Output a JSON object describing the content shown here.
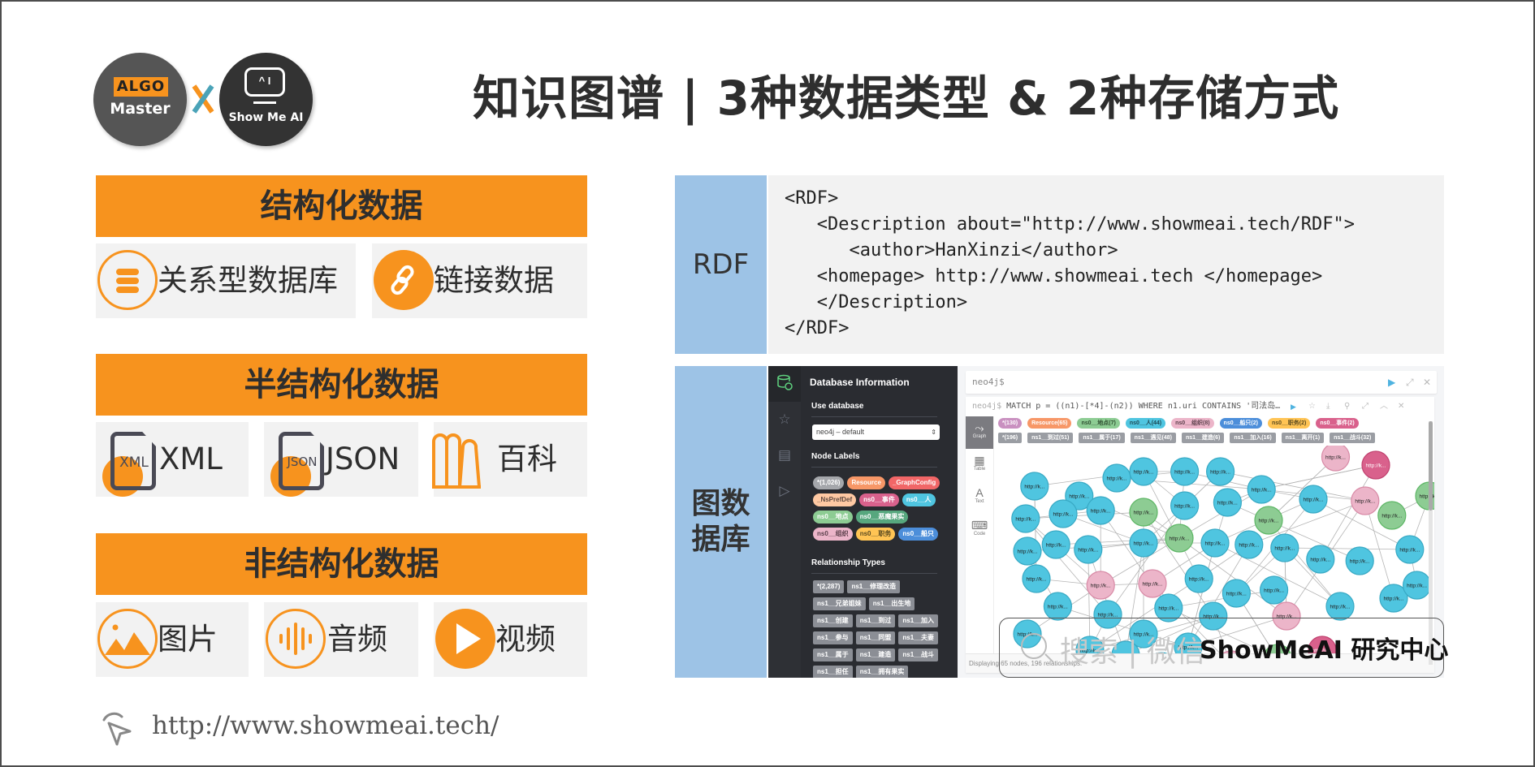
{
  "title": "知识图谱 | 3种数据类型 & 2种存储方式",
  "logos": {
    "algo_badge": "ALGO",
    "algo_master": "Master",
    "separator": "x",
    "showme_screen": "^ I",
    "showme_text": "Show Me AI"
  },
  "categories": [
    {
      "header": "结构化数据",
      "items": [
        {
          "label": "关系型数据库",
          "icon": "database-icon"
        },
        {
          "label": "链接数据",
          "icon": "link-icon"
        }
      ]
    },
    {
      "header": "半结构化数据",
      "items": [
        {
          "label": "XML",
          "icon": "xml-file-icon",
          "icon_text": "XML"
        },
        {
          "label": "JSON",
          "icon": "json-file-icon",
          "icon_text": "JSON"
        },
        {
          "label": "百科",
          "icon": "books-icon"
        }
      ]
    },
    {
      "header": "非结构化数据",
      "items": [
        {
          "label": "图片",
          "icon": "image-icon"
        },
        {
          "label": "音频",
          "icon": "audio-icon"
        },
        {
          "label": "视频",
          "icon": "video-play-icon"
        }
      ]
    }
  ],
  "storage": {
    "rdf": {
      "label": "RDF",
      "code_lines": [
        "<RDF>",
        "   <Description about=\"http://www.showmeai.tech/RDF\">",
        "      <author>HanXinzi</author>",
        "   <homepage> http://www.showmeai.tech </homepage>",
        "   </Description>",
        "</RDF>"
      ]
    },
    "graph_db": {
      "label_line1": "图数",
      "label_line2": "据库",
      "neo4j": {
        "panel_title": "Database Information",
        "use_database_label": "Use database",
        "database_selected": "neo4j – default",
        "node_labels_title": "Node Labels",
        "node_labels": [
          {
            "text": "*(1,026)",
            "color": "#a5a7ab"
          },
          {
            "text": "Resource",
            "color": "#f79767"
          },
          {
            "text": "_GraphConfig",
            "color": "#f16667"
          },
          {
            "text": "_NsPrefDef",
            "color": "#ffc9a3",
            "text_color": "#604a40"
          },
          {
            "text": "ns0__事件",
            "color": "#d9618c"
          },
          {
            "text": "ns0__人",
            "color": "#4fc5e0"
          },
          {
            "text": "ns0__地点",
            "color": "#8dcc93"
          },
          {
            "text": "ns0__恶魔果实",
            "color": "#57a77e"
          },
          {
            "text": "ns0__组织",
            "color": "#ecb5c9",
            "text_color": "#5a3f4a"
          },
          {
            "text": "ns0__职务",
            "color": "#ffc454",
            "text_color": "#5a4a20"
          },
          {
            "text": "ns0__船只",
            "color": "#4c8eda"
          }
        ],
        "relationship_types_title": "Relationship Types",
        "relationship_types": [
          "*(2,287)",
          "ns1__修理改造",
          "ns1__兄弟姐妹",
          "ns1__出生地",
          "ns1__创建",
          "ns1__到过",
          "ns1__加入",
          "ns1__参与",
          "ns1__同盟",
          "ns1__夫妻",
          "ns1__属于",
          "ns1__建造",
          "ns1__战斗",
          "ns1__担任",
          "ns1__拥有果实"
        ],
        "editor_prompt": "neo4j$",
        "query_prefix": "neo4j$",
        "query": " MATCH p = ((n1)-[*4]-(n2)) WHERE n1.uri CONTAINS '司法岛…",
        "view_tabs": [
          {
            "label": "Graph",
            "glyph": "⤳",
            "active": true
          },
          {
            "label": "Table",
            "glyph": "▦",
            "active": false
          },
          {
            "label": "Text",
            "glyph": "A",
            "active": false
          },
          {
            "label": "Code",
            "glyph": "⌨",
            "active": false
          }
        ],
        "result_node_labels": [
          {
            "text": "*(130)",
            "color": "#c990c0"
          },
          {
            "text": "Resource(65)",
            "color": "#f79767"
          },
          {
            "text": "ns0__地点(7)",
            "color": "#8dcc93",
            "text_color": "#2f4f31"
          },
          {
            "text": "ns0__人(44)",
            "color": "#4fc5e0",
            "text_color": "#1f4a55"
          },
          {
            "text": "ns0__组织(8)",
            "color": "#ecb5c9",
            "text_color": "#5a3f4a"
          },
          {
            "text": "ns0__船只(2)",
            "color": "#4c8eda"
          },
          {
            "text": "ns0__职务(2)",
            "color": "#ffc454",
            "text_color": "#5a4a20"
          },
          {
            "text": "ns0__事件(2)",
            "color": "#d9618c"
          }
        ],
        "result_rel_types": [
          "*(196)",
          "ns1__到过(51)",
          "ns1__属于(17)",
          "ns1__遇见(48)",
          "ns1__建造(6)",
          "ns1__加入(16)",
          "ns1__离开(1)",
          "ns1__战斗(32)"
        ],
        "node_caption": "http://k...",
        "footer_status": "Displaying 65 nodes, 196 relationships."
      }
    }
  },
  "watermark": {
    "faded": "搜索 | 微信",
    "brand": "ShowMeAI 研究中心"
  },
  "footer": {
    "url": "http://www.showmeai.tech/"
  },
  "colors": {
    "accent_orange": "#f7931e",
    "side_blue": "#9dc3e6",
    "item_bg": "#f2f2f2",
    "node_blue": "#4fc5e0",
    "node_green": "#8dcc93",
    "node_pink": "#ecb5c9",
    "node_red": "#d9618c"
  }
}
